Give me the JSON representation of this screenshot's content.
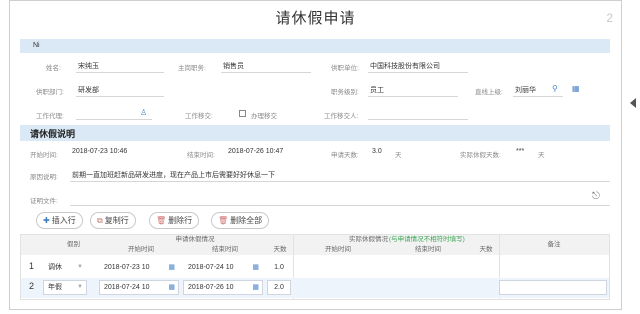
{
  "title": "请休假申请",
  "close_label": "2",
  "user_bar": "Ni",
  "fields": {
    "name_label": "姓名:",
    "name_value": "宋纯玉",
    "post_label": "主岗职务:",
    "post_value": "销售员",
    "unit_label": "供职单位:",
    "unit_value": "中国科技股份有限公司",
    "dept_label": "供职部门:",
    "dept_value": "研发部",
    "level_label": "职务级别:",
    "level_value": "员工",
    "superior_label": "直线上级:",
    "superior_value": "刘丽华",
    "agent_label": "工作代理:",
    "handover_label": "工作移交:",
    "handover_checkbox_label": "办理移交",
    "handover_person_label": "工作移交人:"
  },
  "section": {
    "title": "请休假说明",
    "start_label": "开始时间:",
    "start_value": "2018-07-23 10:46",
    "end_label": "结束时间:",
    "end_value": "2018-07-26 10:47",
    "apply_days_label": "申请天数:",
    "apply_days_value": "3.0",
    "apply_days_unit": "天",
    "actual_days_label": "实际休假天数:",
    "actual_days_value": "***",
    "actual_days_unit": "天",
    "reason_label": "原因说明:",
    "reason_value": "前期一直加班赶新品研发进度，现在产品上市后需要好好休息一下",
    "attach_label": "证明文件:"
  },
  "buttons": {
    "add": "插入行",
    "copy": "复制行",
    "delete": "删除行",
    "delete_all": "删除全部"
  },
  "table": {
    "h_leave_type": "假别",
    "h_apply_group": "申请休假情况",
    "h_actual_group": "实际休假情况",
    "h_actual_note": "(与申请情况不相符时填写)",
    "h_remark": "备注",
    "h_start": "开始时间",
    "h_end": "结束时间",
    "h_days": "天数",
    "h_actual_start": "开始时间",
    "h_actual_end": "结束时间",
    "h_actual_days": "天数",
    "rows": [
      {
        "num": "1",
        "type": "调休",
        "start": "2018-07-23 10",
        "end": "2018-07-24 10",
        "days": "1.0"
      },
      {
        "num": "2",
        "type": "年假",
        "start": "2018-07-24 10",
        "end": "2018-07-26 10",
        "days": "2.0"
      }
    ]
  },
  "colors": {
    "bar": "#dbe9f7",
    "accent": "#4a86c8",
    "green_note": "#3aa655"
  }
}
